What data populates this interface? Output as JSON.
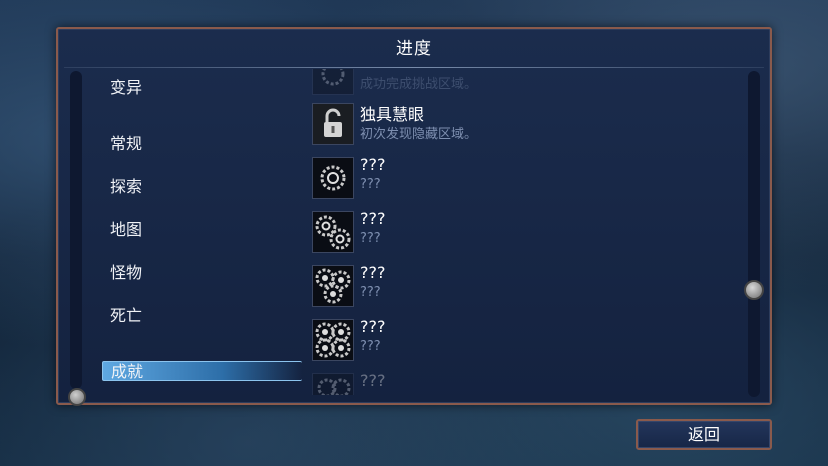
{
  "panel": {
    "title": "进度"
  },
  "categories": [
    {
      "label": "变异"
    },
    {
      "label": "常规"
    },
    {
      "label": "探索"
    },
    {
      "label": "地图"
    },
    {
      "label": "怪物"
    },
    {
      "label": "死亡"
    },
    {
      "label": "成就",
      "active": true
    }
  ],
  "list": {
    "partial_top": {
      "desc": "成功完成挑战区域。"
    },
    "items": [
      {
        "title": "独具慧眼",
        "desc": "初次发现隐藏区域。",
        "icon": "unlocked-padlock-icon"
      },
      {
        "title": "???",
        "desc": "???",
        "icon": "single-gear-icon"
      },
      {
        "title": "???",
        "desc": "???",
        "icon": "double-gear-icon"
      },
      {
        "title": "???",
        "desc": "???",
        "icon": "triple-gear-icon"
      },
      {
        "title": "???",
        "desc": "???",
        "icon": "quad-gear-icon"
      }
    ],
    "partial_bottom": {
      "title": "???"
    }
  },
  "footer": {
    "back_label": "返回"
  }
}
